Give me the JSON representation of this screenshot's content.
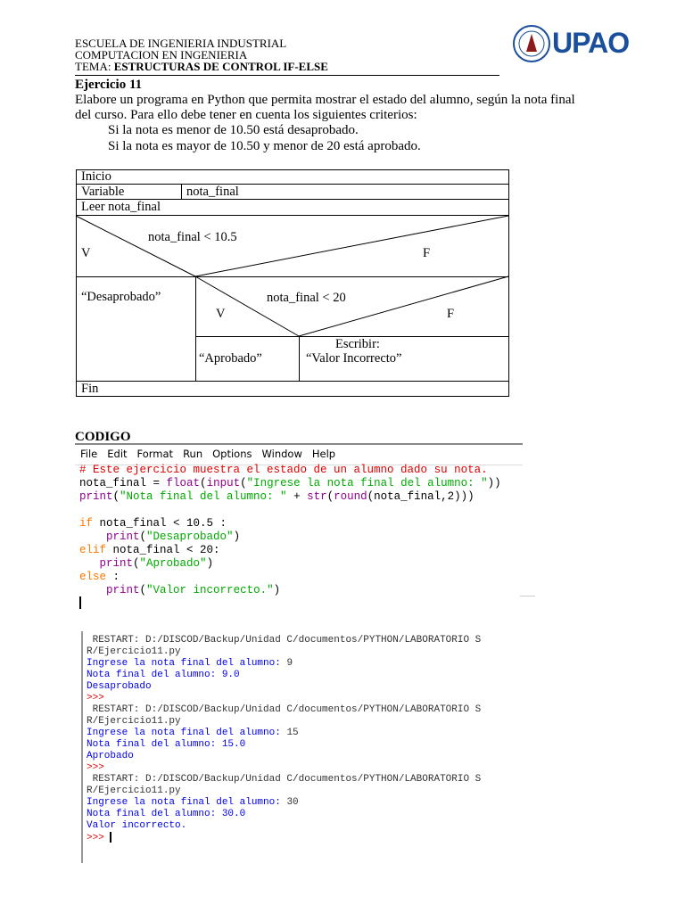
{
  "header": {
    "line1": "ESCUELA DE INGENIERIA INDUSTRIAL",
    "line2": "COMPUTACION EN INGENIERIA",
    "tema_label": "TEMA: ",
    "tema_value": "ESTRUCTURAS DE CONTROL IF-ELSE",
    "logo": "UPAO"
  },
  "exercise": {
    "title": "Ejercicio 11",
    "para1": "Elabore un programa en Python que permita  mostrar  el estado del alumno, según la nota final",
    "para2": "del curso. Para ello debe tener en cuenta los siguientes criterios:",
    "bullet_glyph": "",
    "bullets": [
      "Si la nota es menor de 10.50 está desaprobado.",
      "Si la nota es mayor de 10.50 y menor de 20 está aprobado."
    ]
  },
  "diagram": {
    "inicio": "Inicio",
    "variable": "Variable",
    "variable_value": "nota_final",
    "leer": "Leer nota_final",
    "cond1": "nota_final < 10.5",
    "v": "V",
    "f": "F",
    "desaprobado": "“Desaprobado”",
    "cond2": "nota_final < 20",
    "aprobado": "“Aprobado”",
    "escribir": "Escribir:",
    "valor_incorrecto": "“Valor Incorrecto”",
    "fin": "Fin"
  },
  "codigo_title": "CODIGO",
  "editor": {
    "menu": [
      "File",
      "Edit",
      "Format",
      "Run",
      "Options",
      "Window",
      "Help"
    ],
    "lines": [
      [
        [
          "red",
          "# Este ejercicio muestra el estado de un alumno dado su nota."
        ]
      ],
      [
        [
          "",
          "nota_final = "
        ],
        [
          "purple",
          "float"
        ],
        [
          "",
          "("
        ],
        [
          "purple",
          "input"
        ],
        [
          "",
          "("
        ],
        [
          "green",
          "\"Ingrese la nota final del alumno: \""
        ],
        [
          "",
          "))"
        ]
      ],
      [
        [
          "purple",
          "print"
        ],
        [
          "",
          "("
        ],
        [
          "green",
          "\"Nota final del alumno: \""
        ],
        [
          "",
          " + "
        ],
        [
          "purple",
          "str"
        ],
        [
          "",
          "("
        ],
        [
          "purple",
          "round"
        ],
        [
          "",
          "(nota_final,2)))"
        ]
      ],
      [
        [
          "",
          ""
        ]
      ],
      [
        [
          "orange",
          "if"
        ],
        [
          "",
          " nota_final < 10.5 :"
        ]
      ],
      [
        [
          "",
          "    "
        ],
        [
          "purple",
          "print"
        ],
        [
          "",
          "("
        ],
        [
          "green",
          "\"Desaprobado\""
        ],
        [
          "",
          ")"
        ]
      ],
      [
        [
          "orange",
          "elif"
        ],
        [
          "",
          " nota_final < 20:"
        ]
      ],
      [
        [
          "",
          "   "
        ],
        [
          "purple",
          "print"
        ],
        [
          "",
          "("
        ],
        [
          "green",
          "\"Aprobado\""
        ],
        [
          "",
          ")"
        ]
      ],
      [
        [
          "orange",
          "else"
        ],
        [
          "",
          " :"
        ]
      ],
      [
        [
          "",
          "    "
        ],
        [
          "purple",
          "print"
        ],
        [
          "",
          "("
        ],
        [
          "green",
          "\"Valor incorrecto.\""
        ],
        [
          "",
          ")"
        ]
      ]
    ]
  },
  "console": {
    "lines": [
      [
        [
          "",
          " RESTART: D:/DISCOD/Backup/Unidad C/documentos/PYTHON/LABORATORIO S"
        ]
      ],
      [
        [
          "",
          "R/Ejercicio11.py"
        ]
      ],
      [
        [
          "blue",
          "Ingrese la nota final del alumno: "
        ],
        [
          "",
          "9"
        ]
      ],
      [
        [
          "blue",
          "Nota final del alumno: 9.0"
        ]
      ],
      [
        [
          "blue",
          "Desaprobado"
        ]
      ],
      [
        [
          "red",
          ">>>"
        ]
      ],
      [
        [
          "",
          " RESTART: D:/DISCOD/Backup/Unidad C/documentos/PYTHON/LABORATORIO S"
        ]
      ],
      [
        [
          "",
          "R/Ejercicio11.py"
        ]
      ],
      [
        [
          "blue",
          "Ingrese la nota final del alumno: "
        ],
        [
          "",
          "15"
        ]
      ],
      [
        [
          "blue",
          "Nota final del alumno: 15.0"
        ]
      ],
      [
        [
          "blue",
          "Aprobado"
        ]
      ],
      [
        [
          "red",
          ">>>"
        ]
      ],
      [
        [
          "",
          " RESTART: D:/DISCOD/Backup/Unidad C/documentos/PYTHON/LABORATORIO S"
        ]
      ],
      [
        [
          "",
          "R/Ejercicio11.py"
        ]
      ],
      [
        [
          "blue",
          "Ingrese la nota final del alumno: "
        ],
        [
          "",
          "30"
        ]
      ],
      [
        [
          "blue",
          "Nota final del alumno: 30.0"
        ]
      ],
      [
        [
          "blue",
          "Valor incorrecto."
        ]
      ],
      [
        [
          "red",
          ">>> "
        ]
      ]
    ]
  }
}
